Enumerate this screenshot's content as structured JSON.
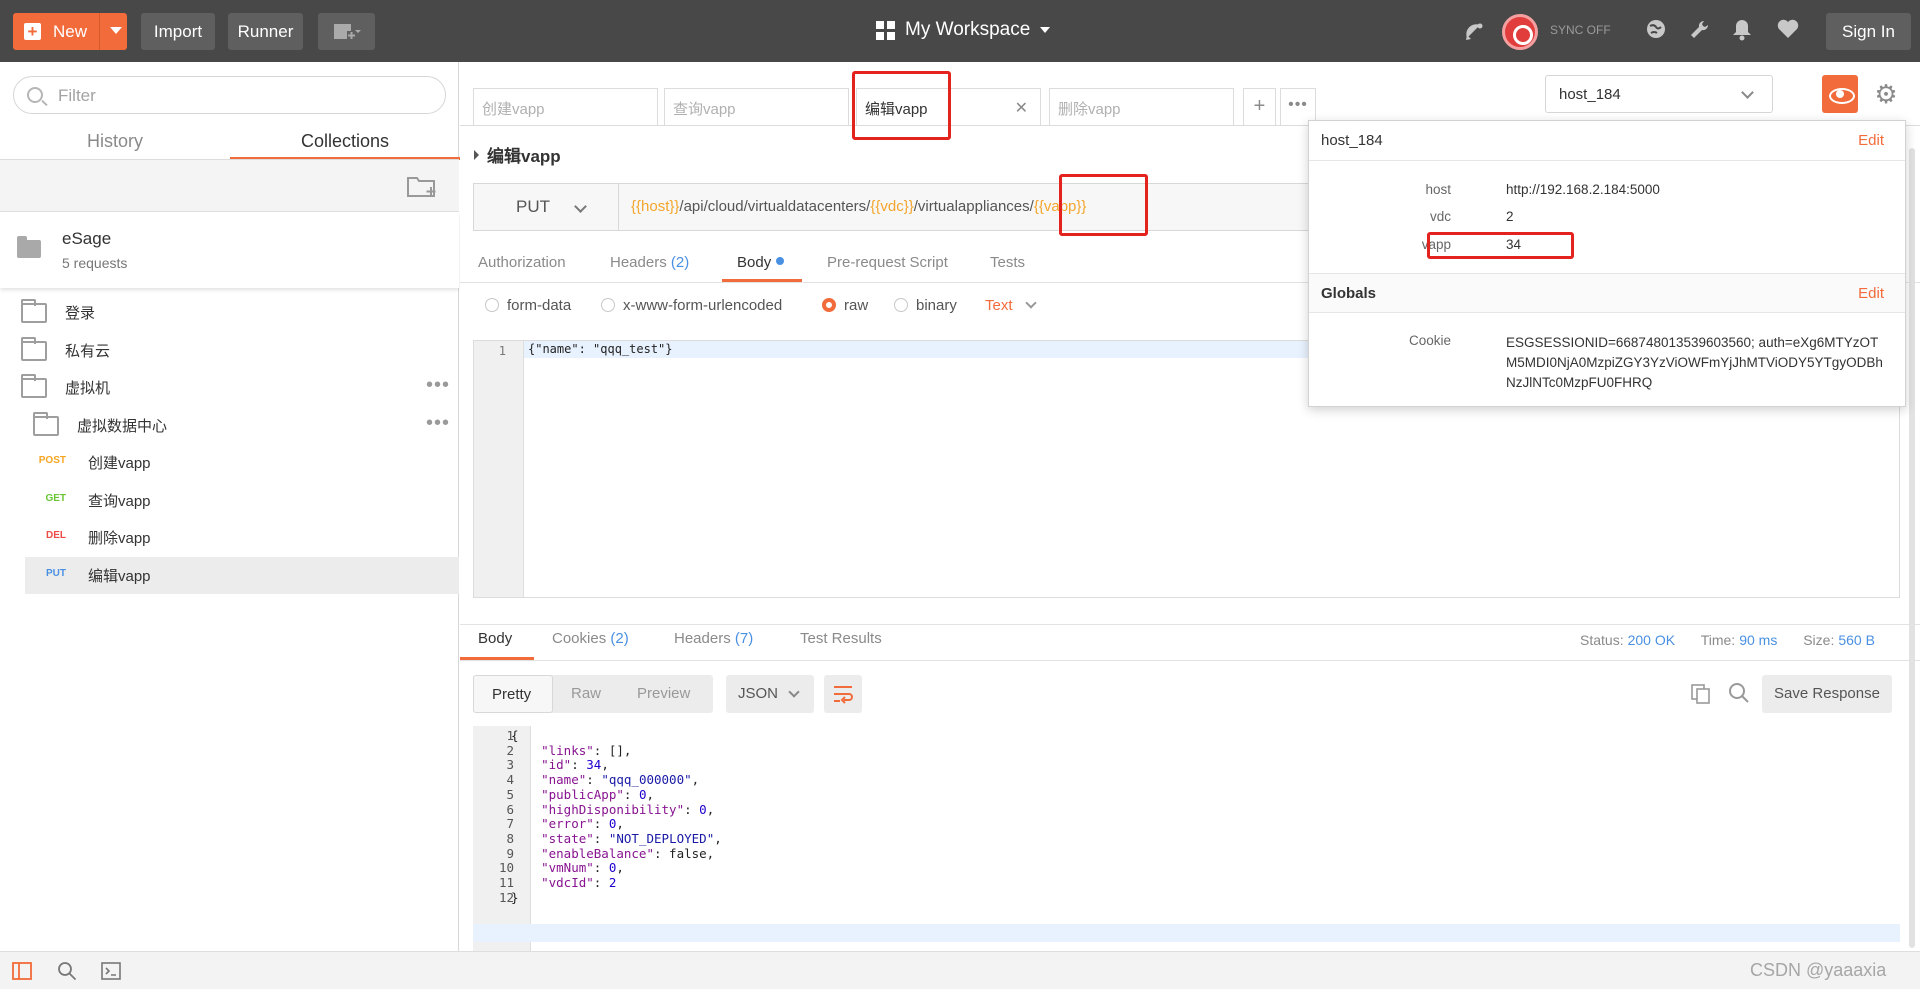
{
  "colors": {
    "accent": "#f26b3a",
    "topbar": "#484848",
    "link": "#4a90e2",
    "highlight": "#e4231e"
  },
  "topbar": {
    "new_label": "New",
    "import_label": "Import",
    "runner_label": "Runner",
    "workspace": "My Workspace",
    "sync_label": "SYNC OFF",
    "signin_label": "Sign In"
  },
  "sidebar": {
    "filter_placeholder": "Filter",
    "tabs": [
      "History",
      "Collections"
    ],
    "collection": {
      "name": "eSage",
      "count": "5 requests"
    },
    "folders": [
      {
        "label": "登录"
      },
      {
        "label": "私有云"
      },
      {
        "label": "虚拟机"
      },
      {
        "label": "虚拟数据中心"
      }
    ],
    "requests": [
      {
        "method": "POST",
        "label": "创建vapp"
      },
      {
        "method": "GET",
        "label": "查询vapp"
      },
      {
        "method": "DEL",
        "label": "删除vapp"
      },
      {
        "method": "PUT",
        "label": "编辑vapp"
      }
    ]
  },
  "tabs": [
    {
      "label": "创建vapp"
    },
    {
      "label": "查询vapp"
    },
    {
      "label": "编辑vapp"
    },
    {
      "label": "删除vapp"
    }
  ],
  "request": {
    "name": "编辑vapp",
    "method": "PUT",
    "url_parts": [
      {
        "text": "{{host}}",
        "var": true
      },
      {
        "text": "/api/cloud/virtualdatacenters/",
        "var": false
      },
      {
        "text": "{{vdc}}",
        "var": true
      },
      {
        "text": "/virtualappliances/",
        "var": false
      },
      {
        "text": "{{vapp}}",
        "var": true
      }
    ],
    "subtabs": {
      "authorization": "Authorization",
      "headers": "Headers",
      "headers_count": "(2)",
      "body": "Body",
      "prerequest": "Pre-request Script",
      "tests": "Tests"
    },
    "body_modes": [
      "form-data",
      "x-www-form-urlencoded",
      "raw",
      "binary"
    ],
    "body_mode_selected": "raw",
    "content_type": "Text",
    "body_line_no": "1",
    "body_code": "{\"name\": \"qqq_test\"}"
  },
  "response": {
    "tabs": {
      "body": "Body",
      "cookies": "Cookies",
      "cookies_count": "(2)",
      "headers": "Headers",
      "headers_count": "(7)",
      "tests": "Test Results"
    },
    "status_label": "Status:",
    "status": "200 OK",
    "time_label": "Time:",
    "time": "90 ms",
    "size_label": "Size:",
    "size": "560 B",
    "formats": [
      "Pretty",
      "Raw",
      "Preview"
    ],
    "format_type": "JSON",
    "save_label": "Save Response",
    "lines": [
      [
        {
          "t": "{",
          "c": "jp"
        }
      ],
      [
        {
          "t": "    \"links\"",
          "c": "jk"
        },
        {
          "t": ": [],",
          "c": "jp"
        }
      ],
      [
        {
          "t": "    \"id\"",
          "c": "jk"
        },
        {
          "t": ": ",
          "c": "jp"
        },
        {
          "t": "34",
          "c": "jn"
        },
        {
          "t": ",",
          "c": "jp"
        }
      ],
      [
        {
          "t": "    \"name\"",
          "c": "jk"
        },
        {
          "t": ": ",
          "c": "jp"
        },
        {
          "t": "\"qqq_000000\"",
          "c": "js"
        },
        {
          "t": ",",
          "c": "jp"
        }
      ],
      [
        {
          "t": "    \"publicApp\"",
          "c": "jk"
        },
        {
          "t": ": ",
          "c": "jp"
        },
        {
          "t": "0",
          "c": "jn"
        },
        {
          "t": ",",
          "c": "jp"
        }
      ],
      [
        {
          "t": "    \"highDisponibility\"",
          "c": "jk"
        },
        {
          "t": ": ",
          "c": "jp"
        },
        {
          "t": "0",
          "c": "jn"
        },
        {
          "t": ",",
          "c": "jp"
        }
      ],
      [
        {
          "t": "    \"error\"",
          "c": "jk"
        },
        {
          "t": ": ",
          "c": "jp"
        },
        {
          "t": "0",
          "c": "jn"
        },
        {
          "t": ",",
          "c": "jp"
        }
      ],
      [
        {
          "t": "    \"state\"",
          "c": "jk"
        },
        {
          "t": ": ",
          "c": "jp"
        },
        {
          "t": "\"NOT_DEPLOYED\"",
          "c": "js"
        },
        {
          "t": ",",
          "c": "jp"
        }
      ],
      [
        {
          "t": "    \"enableBalance\"",
          "c": "jk"
        },
        {
          "t": ": false,",
          "c": "jp"
        }
      ],
      [
        {
          "t": "    \"vmNum\"",
          "c": "jk"
        },
        {
          "t": ": ",
          "c": "jp"
        },
        {
          "t": "0",
          "c": "jn"
        },
        {
          "t": ",",
          "c": "jp"
        }
      ],
      [
        {
          "t": "    \"vdcId\"",
          "c": "jk"
        },
        {
          "t": ": ",
          "c": "jp"
        },
        {
          "t": "2",
          "c": "jn"
        }
      ],
      [
        {
          "t": "}",
          "c": "jp"
        }
      ]
    ]
  },
  "environment": {
    "selected": "host_184",
    "popup_title": "host_184",
    "edit_label": "Edit",
    "vars": [
      {
        "key": "host",
        "value": "http://192.168.2.184:5000"
      },
      {
        "key": "vdc",
        "value": "2"
      },
      {
        "key": "vapp",
        "value": "34"
      }
    ],
    "globals_title": "Globals",
    "globals": [
      {
        "key": "Cookie",
        "value": "ESGSESSIONID=668748013539603560; auth=eXg6MTYzOTM5MDI0NjA0MzpiZGY3YzViOWFmYjJhMTViODY5YTgyODBhNzJlNTc0MzpFU0FHRQ"
      }
    ]
  },
  "watermark": "CSDN @yaaaxia"
}
